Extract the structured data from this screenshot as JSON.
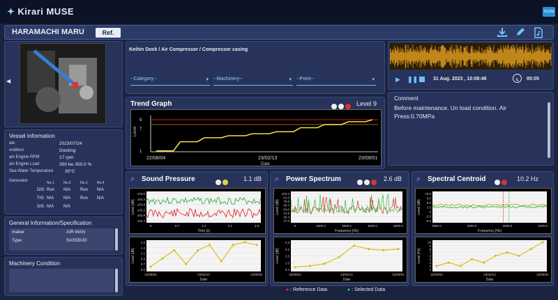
{
  "app": {
    "title": "Kirari MUSE",
    "corner_badge": "OLDSI"
  },
  "ship": {
    "name": "HARAMACHI MARU",
    "ref_label": "Ref."
  },
  "toolbar": {
    "download_icon": "download-icon",
    "edit_icon": "pencil-icon",
    "file_icon": "music-file-icon"
  },
  "vessel": {
    "title": "Vessel Information",
    "rows": [
      {
        "label": "ate",
        "value": "2023/07/24"
      },
      {
        "label": "ondition",
        "value": "Docking"
      },
      {
        "label": "ain Engine RPM",
        "value": "17 rpm"
      },
      {
        "label": "ain Engine Load",
        "value": "350 kw  350.0 %"
      },
      {
        "label": "Sea Water Temperature",
        "value": "30°C"
      }
    ],
    "generator_label": "Generator",
    "gen_headers": [
      "No.1",
      "No.2",
      "No.3",
      "No.4"
    ],
    "gen_rows": [
      {
        "label": "D/G",
        "cells": [
          "Run",
          "N/A",
          "Run",
          "N/A"
        ]
      },
      {
        "label": "T/G",
        "cells": [
          "N/A",
          "N/A",
          "Run",
          "N/A"
        ]
      },
      {
        "label": "S/G",
        "cells": [
          "N/A",
          "N/A",
          "",
          ""
        ]
      }
    ]
  },
  "general": {
    "title": "General Information/Specification",
    "rows": [
      {
        "label": "maker",
        "value": "AIR MAN"
      },
      {
        "label": "Type",
        "value": "SAS55UD"
      }
    ]
  },
  "machinery_condition": {
    "title": "Machinery Condition"
  },
  "selector": {
    "path": "Keihin Dock / Air Compressor / Compressor casing",
    "category": "--Category--",
    "machinery": "--Machinery--",
    "point": "--Point--"
  },
  "player": {
    "datetime": "31 Aug. 2023 , 10:08:48",
    "time": "00:05"
  },
  "comment": {
    "title": "Comment",
    "text": "Before maintenance. Un load condition. Air Press:0.70MPa"
  },
  "trend": {
    "title": "Trend Graph",
    "level": "Level 9",
    "ylabel": "Level",
    "xlabel": "Date",
    "xticks": [
      "22/08/04",
      "23/02/13",
      "23/09/01"
    ],
    "yticks": [
      "9",
      "7",
      "1"
    ]
  },
  "sound": {
    "title": "Sound Pressure",
    "value": "1.1 dB",
    "top": {
      "ylabel": "Level [dB]",
      "xlabel": "Time [s]",
      "yticks": [
        "104.6",
        "104.3",
        "103.9",
        "103.2",
        "102.8",
        "102.4"
      ],
      "xticks": [
        "0",
        "8.7",
        "1.4",
        "2.1",
        "2.8"
      ]
    },
    "bottom": {
      "ylabel": "Level [dB]",
      "xlabel": "Date",
      "yticks": [
        "1.5",
        "1.3",
        "1.1",
        "0.9",
        "0.7",
        "0.5"
      ],
      "xticks": [
        "22/08/04",
        "23/02/13",
        "23/09/01"
      ]
    }
  },
  "power": {
    "title": "Power Spectrum",
    "value": "2.6 dB",
    "top": {
      "ylabel": "Level [dB]",
      "xlabel": "Frequency [Hz]",
      "yticks": [
        "103.3",
        "91.0",
        "78.6",
        "66.3",
        "54.0",
        "41.6",
        "29.3",
        "17.0"
      ],
      "xticks": [
        "0",
        "1500.0",
        "3000.0",
        "4500.0",
        "6000.0"
      ]
    },
    "bottom": {
      "ylabel": "Level [dB]",
      "xlabel": "Date",
      "yticks": [
        "2.8",
        "2.2",
        "1.6",
        "1.0",
        "0.4"
      ],
      "xticks": [
        "22/08/04",
        "23/02/13",
        "23/09/01"
      ]
    }
  },
  "centroid": {
    "title": "Spectral Centroid",
    "value": "10.2 Hz",
    "top": {
      "ylabel": "Level [dB]",
      "xlabel": "Frequency [Hz]",
      "yticks": [
        "10.5",
        "8.0",
        "5.0",
        "2.5",
        "0",
        "-2.5",
        "-5.0"
      ],
      "xticks": [
        "2950.0",
        "3000.0",
        "3050.0",
        "3100.0"
      ]
    },
    "bottom": {
      "ylabel": "Level [Hz]",
      "xlabel": "Date",
      "yticks": [
        "10",
        "9",
        "8",
        "7",
        "6",
        "5",
        "4",
        "3",
        "2"
      ],
      "xticks": [
        "22/09/04",
        "23/02/13",
        "23/09/01"
      ]
    }
  },
  "legend": {
    "reference": ": Reference Data",
    "selected": ": Selected Data",
    "reference_color": "#e03030",
    "selected_color": "#30d040"
  },
  "colors": {
    "accent": "#6ec1ff",
    "trend_line": "#f2e04a",
    "threshold": "#c02020",
    "warning": "#e8d43a",
    "danger": "#e03030"
  },
  "chart_data": [
    {
      "type": "line",
      "title": "Trend Graph",
      "x": [
        "22/08/04",
        "22/09",
        "22/10",
        "22/12",
        "23/01",
        "23/02/13",
        "23/04",
        "23/06",
        "23/08",
        "23/09/01"
      ],
      "series": [
        {
          "values": [
            1.2,
            3.5,
            4.5,
            5.0,
            5.5,
            6.0,
            7.0,
            7.8,
            8.5,
            9.0
          ]
        }
      ]
    },
    {
      "type": "line",
      "title": "Sound Pressure trend",
      "x": [
        "22/08/04",
        "22/09",
        "22/11",
        "22/12",
        "23/01",
        "23/02/13",
        "23/04",
        "23/06",
        "23/08",
        "23/09/01"
      ],
      "series": [
        {
          "values": [
            0.6,
            0.9,
            1.2,
            0.7,
            1.2,
            1.4,
            0.8,
            1.4,
            1.5,
            1.4
          ]
        }
      ]
    },
    {
      "type": "line",
      "title": "Power Spectrum trend",
      "x": [
        "22/08/04",
        "22/10",
        "22/12",
        "23/02/13",
        "23/04",
        "23/06",
        "23/08",
        "23/09/01"
      ],
      "series": [
        {
          "values": [
            0.6,
            0.7,
            0.9,
            1.5,
            2.5,
            2.2,
            2.1,
            2.2
          ]
        }
      ]
    },
    {
      "type": "line",
      "title": "Spectral Centroid trend",
      "x": [
        "22/09/04",
        "22/10",
        "22/11",
        "22/12",
        "23/01",
        "23/02/13",
        "23/04",
        "23/05",
        "23/07",
        "23/09/01"
      ],
      "series": [
        {
          "values": [
            3,
            4,
            3,
            5,
            4,
            6,
            7,
            6,
            8,
            10
          ]
        }
      ]
    }
  ]
}
